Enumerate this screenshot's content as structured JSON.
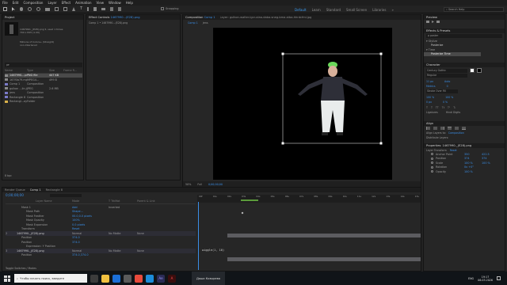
{
  "menu": [
    "File",
    "Edit",
    "Composition",
    "Layer",
    "Effect",
    "Animation",
    "View",
    "Window",
    "Help"
  ],
  "toolbar": {
    "snapping": "Snapping"
  },
  "workspaces": [
    "Default",
    "Learn",
    "Standard",
    "Small Screen",
    "Libraries"
  ],
  "workspace_active": "Default",
  "search_help": "Search Help",
  "project": {
    "tab": "Project",
    "thumb_title": "1467990-_(E28).png",
    "thumb_info": "1467990-_(E28).png ▾, used 1 times\n700 x 845 (1.00)",
    "thumb_info2": "Millions of Colors+ (Straight)\nnon-Interlaced",
    "search_placeholder": "ρ▾",
    "columns": [
      "Name",
      "Type",
      "Size",
      "Frame R..."
    ],
    "items": [
      {
        "name": "1467990....png",
        "type": "PNG file",
        "size": "447 KB",
        "sel": true
      },
      {
        "name": "167f0b79.mp4",
        "type": "MPEG4...",
        "size": "499 B"
      },
      {
        "name": "Comp 1",
        "type": "Composition",
        "size": ""
      },
      {
        "name": "gulkon ...lin.jpg",
        "type": "JPEG",
        "size": "2.6 MB"
      },
      {
        "name": "jens",
        "type": "Composition",
        "size": ""
      },
      {
        "name": "Rectangle 8",
        "type": "Composition",
        "size": ""
      },
      {
        "name": "Rectangl...ayers",
        "type": "Folder",
        "size": ""
      }
    ],
    "footer": "8 bpc"
  },
  "effect_controls": {
    "tab": "Effect Controls",
    "file": "1467990...(E28).png",
    "sub": "Comp 1 • 1467990...(E28).png"
  },
  "composition": {
    "tab": "Composition",
    "name": "Comp 1",
    "layer_tab": "Layer: gulkon-walter-lgcr-olaa-daba-sneg-bma-stba-hhrdcfmi.jpg",
    "subtabs": [
      "Comp 1",
      "jens"
    ],
    "zoom": "50%",
    "quality": "Full",
    "timecode": "0;00;00;00"
  },
  "timeline": {
    "tabs": [
      "Render Queue",
      "Comp 1",
      "Rectangle 8"
    ],
    "active_tab": "Comp 1",
    "timecode": "0;00;00;00",
    "columns": [
      "Layer Name",
      "Mode",
      "T TrkMat",
      "Parent & Link"
    ],
    "ruler": [
      "00f",
      "01s",
      "02s",
      "03s",
      "04s",
      "05s",
      "06s",
      "07s",
      "08s",
      "09s",
      "10s",
      "11s",
      "12s",
      "13s",
      "14s",
      "15s"
    ],
    "rows": [
      {
        "indent": 1,
        "label": "Mask 1",
        "value": "Add",
        "extra": "Inverted"
      },
      {
        "indent": 2,
        "label": "Mask Path",
        "value": "Shape..."
      },
      {
        "indent": 2,
        "label": "Mask Feather",
        "value": "00.0,0.0 pixels"
      },
      {
        "indent": 2,
        "label": "Mask Opacity",
        "value": "100%"
      },
      {
        "indent": 2,
        "label": "Mask Expansion",
        "value": "0.0 pixels"
      },
      {
        "indent": 1,
        "label": "Transform",
        "value": "Reset"
      },
      {
        "indent": 0,
        "num": "2",
        "label": "1467990-_(E28).png",
        "value": "Normal",
        "extra": "No Matte",
        "parent": "None"
      },
      {
        "indent": 1,
        "label": "Position",
        "value": "374.0"
      },
      {
        "indent": 1,
        "label": "Position",
        "value": "374.0"
      },
      {
        "indent": 2,
        "label": "Expression: Y Position",
        "value": ""
      },
      {
        "indent": 0,
        "num": "3",
        "label": "1467990-_(E28).png",
        "value": "Normal",
        "extra": "No Matte",
        "parent": "None"
      },
      {
        "indent": 1,
        "label": "Position",
        "value": "374.0,374.0"
      }
    ],
    "expression": "wiggle(1, 10)",
    "footer": "Toggle Switches / Modes"
  },
  "preview": {
    "tab": "Preview",
    "title": "Effects & Presets",
    "search": "ρ poster",
    "items": [
      "▾ Stylize",
      "Posterize",
      "▾ Time",
      "Posterize Time"
    ]
  },
  "character": {
    "title": "Character",
    "font": "Century Gothic",
    "style": "Regular",
    "size": "11 px",
    "leading": "Auto",
    "tracking": "0",
    "metrics": "Metrics",
    "stroke": "Stroke Over Fill",
    "vscale": "100 %",
    "hscale": "100 %",
    "baseline": "0 px",
    "tsume": "0 %",
    "ligatures": "Ligatures",
    "hindi": "Hindi Digits"
  },
  "align": {
    "title": "Align",
    "align_to_label": "Align Layers to:",
    "align_to": "Composition",
    "distribute": "Distribute Layers:"
  },
  "properties": {
    "title": "Properties: 1467990-_(E28).png",
    "section": "Layer Transform",
    "reset": "Reset",
    "props": [
      {
        "label": "Anchor Point",
        "v1": "350",
        "v2": "422.5"
      },
      {
        "label": "Position",
        "v1": "374",
        "v2": "374"
      },
      {
        "label": "Scale",
        "v1": "100 %",
        "v2": "100 %"
      },
      {
        "label": "Rotation",
        "v1": "0x +0°",
        "v2": ""
      },
      {
        "label": "Opacity",
        "v1": "100 %",
        "v2": ""
      }
    ]
  },
  "taskbar": {
    "search": "Чтобы начать поиск, введите",
    "user": "Даша Козырева",
    "time": "19:17",
    "date": "06.03.2026",
    "lang": "ENG"
  }
}
